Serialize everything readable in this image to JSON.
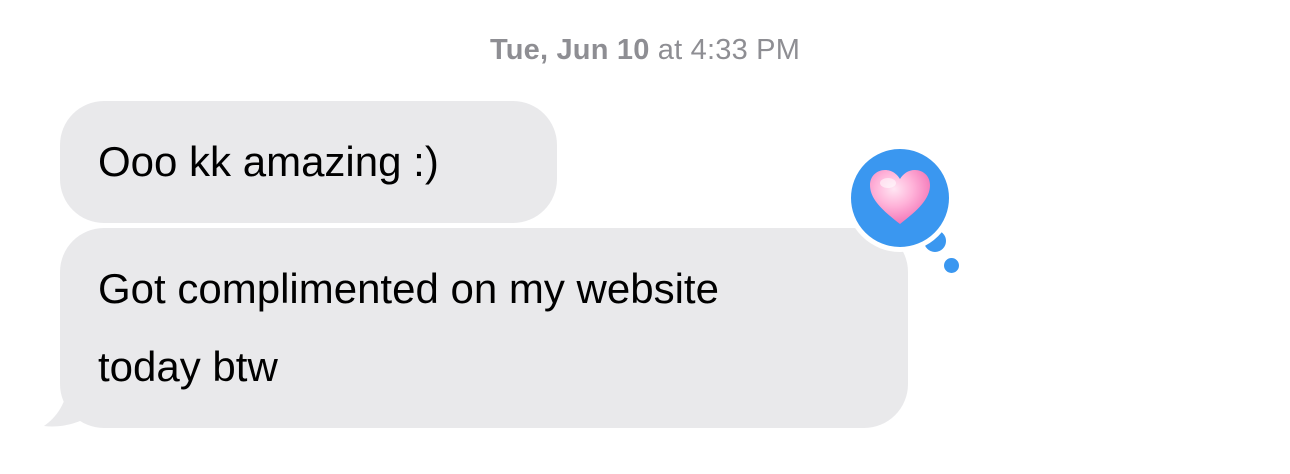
{
  "conversation": {
    "timestamp": {
      "day": "Tue, Jun 10",
      "separator": "at",
      "time": "4:33 PM"
    },
    "messages": [
      {
        "text": "Ooo kk amazing :)",
        "sender": "other"
      },
      {
        "text_line1": "Got complimented on my website",
        "text_line2": "today btw",
        "sender": "other"
      }
    ],
    "reaction": {
      "icon": "heart-icon",
      "target_message": 1
    }
  },
  "colors": {
    "received_bubble": "#e9e9eb",
    "tapback_blue": "#3a97f0",
    "timestamp_gray": "#8e8e93"
  }
}
